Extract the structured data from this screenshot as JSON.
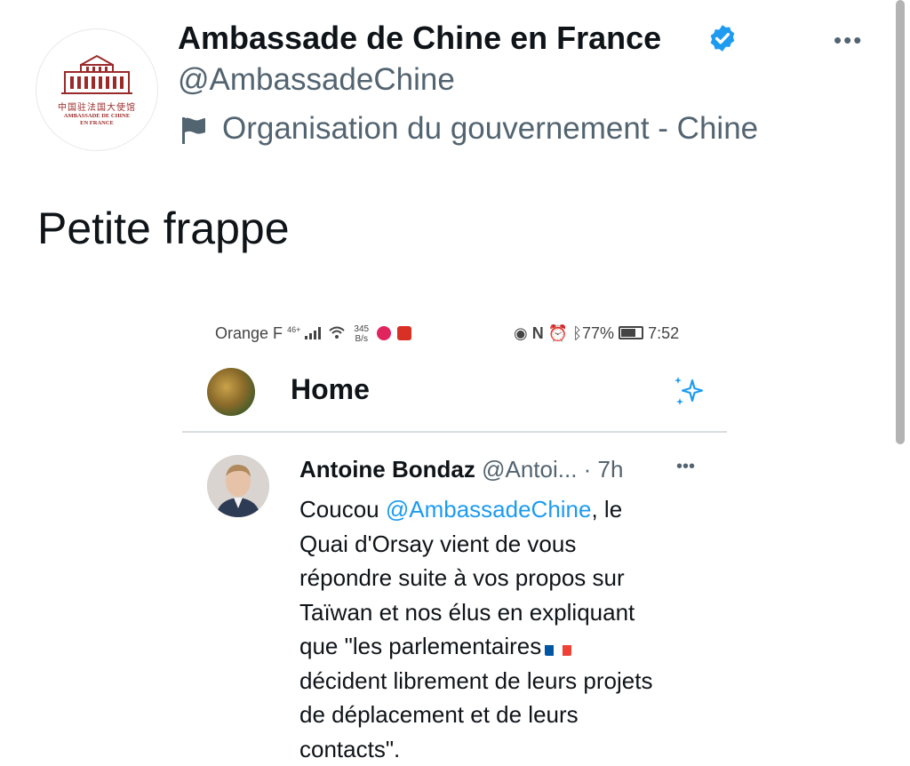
{
  "tweet": {
    "display_name": "Ambassade de Chine en France",
    "handle": "@AmbassadeChine",
    "account_label": "Organisation du gouvernement - Chine",
    "text": "Petite frappe",
    "avatar": {
      "chinese": "中国驻法国大使馆",
      "french_line1": "AMBASSADE DE CHINE",
      "french_line2": "EN FRANCE"
    },
    "more_label": "•••"
  },
  "colors": {
    "text": "#0f1419",
    "secondary": "#536471",
    "accent": "#1d9bf0",
    "logo_red": "#9b2a2a"
  },
  "embedded": {
    "status_bar": {
      "carrier": "Orange F",
      "net": "46+",
      "speed_top": "345",
      "speed_bottom": "B/s",
      "battery": "77%",
      "time": "7:52"
    },
    "header": {
      "title": "Home"
    },
    "tweet": {
      "name": "Antoine Bondaz",
      "handle_time": "@Antoi... · 7h",
      "more_label": "•••",
      "lines": [
        {
          "before": "Coucou ",
          "mention": "@AmbassadeChine",
          "after": ", le"
        },
        {
          "text": "Quai d'Orsay vient de vous"
        },
        {
          "text": "répondre suite à vos propos sur"
        },
        {
          "text": "Taïwan et nos élus en expliquant"
        },
        {
          "text": "que \"les parlementaires"
        },
        {
          "text": "décident librement de leurs projets"
        },
        {
          "text": "de déplacement et de leurs"
        },
        {
          "text": "contacts\"."
        }
      ]
    }
  }
}
